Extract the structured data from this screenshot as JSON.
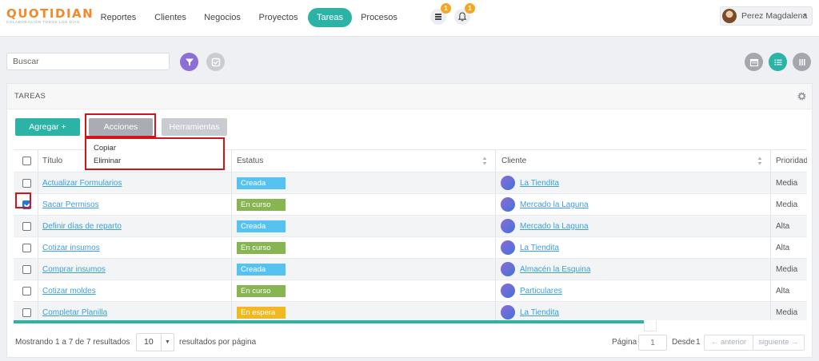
{
  "logo": {
    "main": "QUOTIDIAN",
    "tagline": "COLABORACIÓN TODOS LOS DÍAS"
  },
  "nav": [
    {
      "label": "Reportes",
      "active": false
    },
    {
      "label": "Clientes",
      "active": false
    },
    {
      "label": "Negocios",
      "active": false
    },
    {
      "label": "Proyectos",
      "active": false
    },
    {
      "label": "Tareas",
      "active": true
    },
    {
      "label": "Procesos",
      "active": false
    }
  ],
  "notifications": {
    "list_badge": "1",
    "bell_badge": "1"
  },
  "user": {
    "name": "Perez Magdalena"
  },
  "search": {
    "placeholder": "Buscar",
    "value": ""
  },
  "panel": {
    "title": "TAREAS"
  },
  "toolbar": {
    "add_label": "Agregar +",
    "actions_label": "Acciones",
    "tools_label": "Herramientas",
    "actions_menu": [
      "Copiar",
      "Eliminar"
    ]
  },
  "table": {
    "columns": [
      "Título",
      "Estatus",
      "Cliente",
      "Prioridad"
    ],
    "rows": [
      {
        "checked": false,
        "title": "Actualizar Formularios",
        "status": "Creada",
        "status_kind": "creada",
        "client": "La Tiendita",
        "priority": "Media"
      },
      {
        "checked": true,
        "title": "Sacar Permisos",
        "status": "En curso",
        "status_kind": "curso",
        "client": "Mercado la Laguna",
        "priority": "Media"
      },
      {
        "checked": false,
        "title": "Definir días de reparto",
        "status": "Creada",
        "status_kind": "creada",
        "client": "Mercado la Laguna",
        "priority": "Alta"
      },
      {
        "checked": false,
        "title": "Cotizar insumos",
        "status": "En curso",
        "status_kind": "curso",
        "client": "La Tiendita",
        "priority": "Alta"
      },
      {
        "checked": false,
        "title": "Comprar insumos",
        "status": "Creada",
        "status_kind": "creada",
        "client": "Almacén la Esquina",
        "priority": "Media"
      },
      {
        "checked": false,
        "title": "Cotizar moldes",
        "status": "En curso",
        "status_kind": "curso",
        "client": "Particulares",
        "priority": "Alta"
      },
      {
        "checked": false,
        "title": "Completar Planilla",
        "status": "En espera",
        "status_kind": "espera",
        "client": "La Tiendita",
        "priority": "Media"
      }
    ]
  },
  "footer": {
    "showing": "Mostrando 1 a 7 de 7 resultados",
    "per_page_value": "10",
    "per_page_label": "resultados por página",
    "page_label": "Página",
    "page_value": "1",
    "from_label": "Desde",
    "total_pages": "1",
    "prev_label": "← anterior",
    "next_label": "siguiente →"
  },
  "colors": {
    "accent": "#2bb3a6",
    "brand_orange": "#f08a2a",
    "status_creada": "#55c2f0",
    "status_curso": "#86b552",
    "status_espera": "#f2b91f",
    "highlight": "#d3151b",
    "link": "#3aa0e0"
  },
  "icons": [
    "filter-icon",
    "check-square-icon",
    "calendar-icon",
    "list-icon",
    "columns-icon",
    "gear-icon",
    "tasks-list-icon",
    "bell-icon",
    "sort-icon"
  ]
}
